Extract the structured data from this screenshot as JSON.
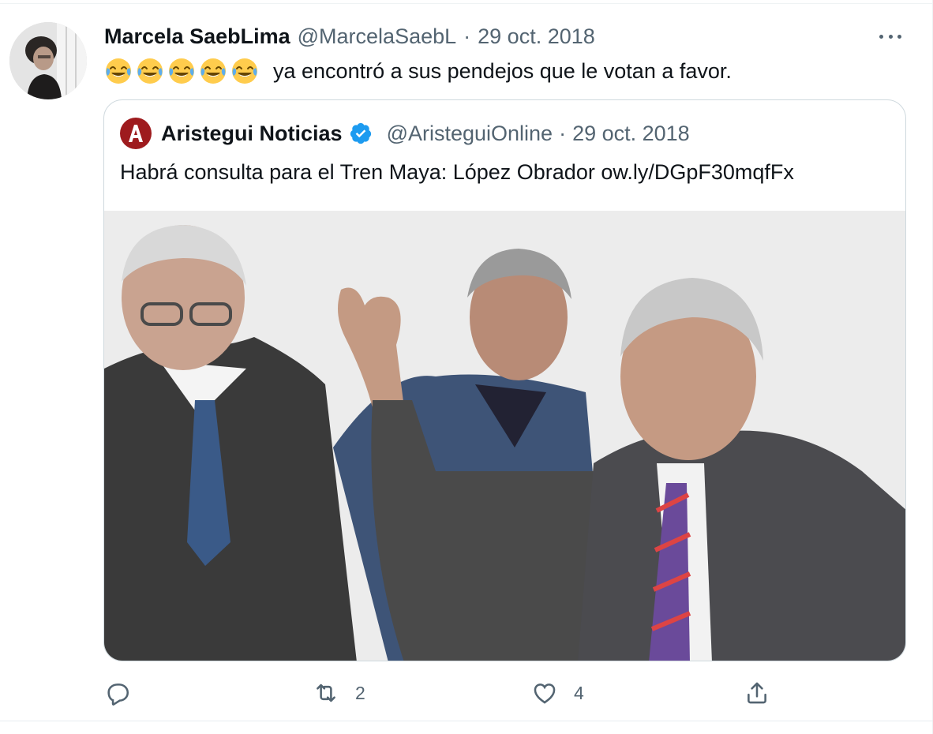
{
  "tweet": {
    "author_name": "Marcela SaebLima",
    "author_handle": "@MarcelaSaebL",
    "separator": "·",
    "date": "29 oct. 2018",
    "emoji_count": 5,
    "emoji_name": "face-with-tears-of-joy",
    "text": "ya encontró a sus pendejos que le votan a favor."
  },
  "quoted": {
    "author_name": "Aristegui Noticias",
    "author_handle": "@AristeguiOnline",
    "separator": "·",
    "date": "29 oct. 2018",
    "text": "Habrá consulta para el Tren Maya: López Obrador ow.ly/DGpF30mqfFx",
    "logo_letter": "A",
    "verified": true,
    "image_description_icon": "news-photo"
  },
  "actions": {
    "reply_count": "",
    "retweet_count": "2",
    "like_count": "4",
    "share_count": ""
  },
  "colors": {
    "text_primary": "#0f1419",
    "text_secondary": "#536471",
    "border": "#cfd9de",
    "verified_blue": "#1d9bf0",
    "logo_red": "#9e1b1e"
  }
}
